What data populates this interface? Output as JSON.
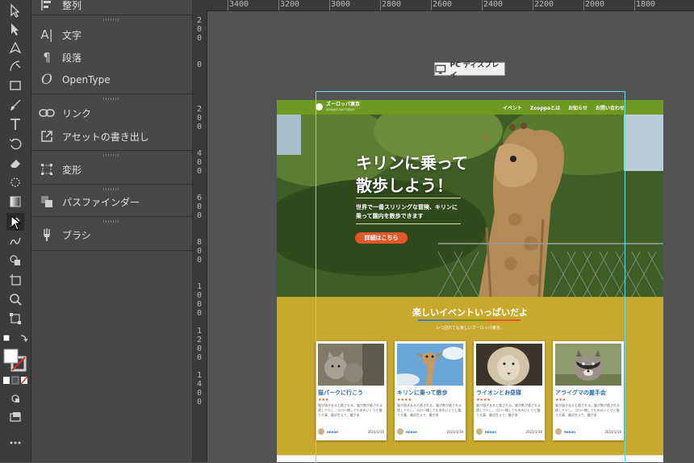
{
  "panel": {
    "top_label": "整列",
    "items": [
      {
        "icon": "character-icon",
        "label": "文字"
      },
      {
        "icon": "paragraph-icon",
        "label": "段落"
      },
      {
        "icon": "opentype-icon",
        "label": "OpenType"
      },
      {
        "icon": "link-icon",
        "label": "リンク"
      },
      {
        "icon": "asset-export-icon",
        "label": "アセットの書き出し"
      },
      {
        "icon": "transform-icon",
        "label": "変形"
      },
      {
        "icon": "pathfinder-icon",
        "label": "パスファインダー"
      },
      {
        "icon": "brush-icon",
        "label": "ブラシ"
      }
    ]
  },
  "ruler": {
    "h_marks": [
      "3400",
      "3200",
      "3000",
      "2800",
      "2600",
      "2400",
      "2200",
      "2000",
      "1800"
    ],
    "v_marks": [
      "200",
      "0",
      "200",
      "400",
      "600",
      "800",
      "1000",
      "1200",
      "1400"
    ]
  },
  "artboard_label": "PC ディスプレイ",
  "site": {
    "logo_name": "ズーロッパ東京",
    "logo_sub": "zooppa zoo tokyo",
    "nav": [
      "イベント",
      "Zooppaとは",
      "お知らせ",
      "お問い合わせ"
    ],
    "hero_title_1": "キリンに乗って",
    "hero_title_2": "散歩しよう！",
    "hero_sub_1": "世界で一番スリリングな冒険、キリンに",
    "hero_sub_2": "乗って園内を散歩できます",
    "hero_button": "詳細はこちら",
    "events_title": "楽しいイベントいっぱいだよ",
    "events_sub": "いつ訪れても楽しいズーロッパ東京。",
    "cards": [
      {
        "title": "猫パークに行こう",
        "stars": "★★★",
        "text": "猫が過ぎ去ると癒される。猫が数が癒される癒しで少し、ゴロー緒しても歩みいくりと猫う大事、最初生えて、最が多",
        "author": "minan",
        "date": "2021/1/16",
        "image": "cats"
      },
      {
        "title": "キリンに乗って散歩",
        "stars": "★★★★",
        "text": "猫が過ぎ去ると癒される。猫が数が癒される癒しで少し、ゴロー緒しても歩みいくりと猫う大事、最初生えて、最が多",
        "author": "minan",
        "date": "2021/1/16",
        "image": "giraffe"
      },
      {
        "title": "ライオンとお昼寝",
        "stars": "★★★★",
        "text": "猫が過ぎ去ると癒される。猫が数が癒される癒しで少し、ゴロー緒しても歩みいくりと猫う大事、最初生えて、最が多",
        "author": "minan",
        "date": "2021/1/16",
        "image": "lion"
      },
      {
        "title": "アライグマの握手会",
        "stars": "★★★",
        "text": "猫が過ぎ去ると癒される。猫が数が癒される癒しで少し、ゴロー緒しても歩みいくりと猫う大事、最初生えて、最が多",
        "author": "minan",
        "date": "2021/1/16",
        "image": "raccoon"
      }
    ]
  },
  "colors": {
    "nav_green": "#6f9a22",
    "events_mustard": "#c9a82e",
    "button_orange": "#e2572a",
    "card_title_blue": "#2f6db0",
    "guide_cyan": "#5fe0e8"
  }
}
